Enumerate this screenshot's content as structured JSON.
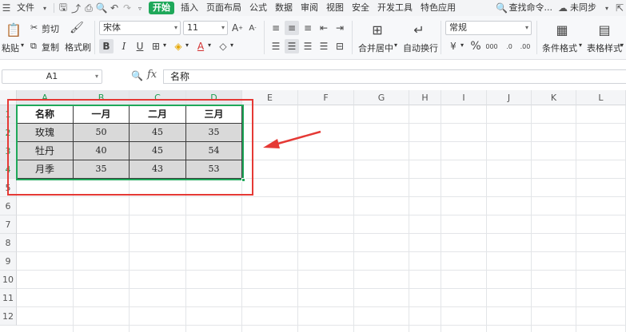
{
  "menubar": {
    "file": "文件",
    "tabs": [
      "开始",
      "插入",
      "页面布局",
      "公式",
      "数据",
      "审阅",
      "视图",
      "安全",
      "开发工具",
      "特色应用"
    ],
    "search": "查找命令...",
    "sync": "未同步"
  },
  "ribbon": {
    "paste": "粘贴",
    "cut": "剪切",
    "copy": "复制",
    "format_painter": "格式刷",
    "font_name": "宋体",
    "font_size": "11",
    "merge_center": "合并居中",
    "wrap_text": "自动换行",
    "number_format": "常规",
    "conditional_format": "条件格式",
    "table_style": "表格样式",
    "bold": "B",
    "italic": "I",
    "underline": "U",
    "percent": "%",
    "thousands": "000"
  },
  "formula_bar": {
    "cell_ref": "A1",
    "fx": "fx",
    "value": "名称"
  },
  "sheet": {
    "columns": [
      "A",
      "B",
      "C",
      "D",
      "E",
      "F",
      "G",
      "H",
      "I",
      "J",
      "K",
      "L"
    ],
    "rows": [
      "1",
      "2",
      "3",
      "4",
      "5",
      "6",
      "7",
      "8",
      "9",
      "10",
      "11",
      "12"
    ],
    "table": {
      "header": [
        "名称",
        "一月",
        "二月",
        "三月"
      ],
      "body": [
        [
          "玫瑰",
          "50",
          "45",
          "35"
        ],
        [
          "牡丹",
          "40",
          "45",
          "54"
        ],
        [
          "月季",
          "35",
          "43",
          "53"
        ]
      ]
    }
  },
  "colors": {
    "accent": "#1fa85a",
    "highlight": "#e53935"
  }
}
